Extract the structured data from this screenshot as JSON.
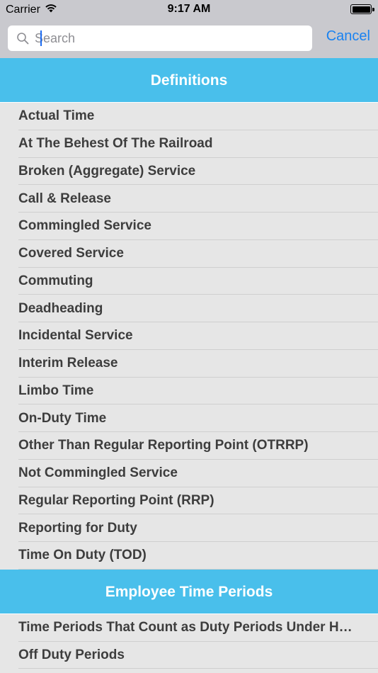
{
  "status_bar": {
    "carrier": "Carrier",
    "time": "9:17 AM",
    "wifi_icon": "wifi-icon",
    "battery_icon": "battery-icon"
  },
  "search": {
    "placeholder": "Search",
    "value": "",
    "icon": "search-icon",
    "cancel_label": "Cancel"
  },
  "colors": {
    "header_bg": "#49bfeb",
    "accent": "#1a82f0",
    "list_bg": "#e6e6e6",
    "search_bar_bg": "#c9c9ce"
  },
  "sections": [
    {
      "title": "Definitions",
      "items": [
        "Actual Time",
        "At The Behest Of The Railroad",
        "Broken (Aggregate) Service",
        "Call & Release",
        "Commingled Service",
        "Covered Service",
        "Commuting",
        "Deadheading",
        "Incidental Service",
        "Interim Release",
        "Limbo Time",
        "On-Duty Time",
        "Other Than Regular Reporting Point (OTRRP)",
        "Not Commingled Service",
        "Regular Reporting Point (RRP)",
        "Reporting for Duty",
        "Time On Duty (TOD)"
      ]
    },
    {
      "title": "Employee Time Periods",
      "items": [
        "Time Periods That Count as Duty Periods Under Hours of…",
        "Off Duty Periods"
      ]
    }
  ]
}
